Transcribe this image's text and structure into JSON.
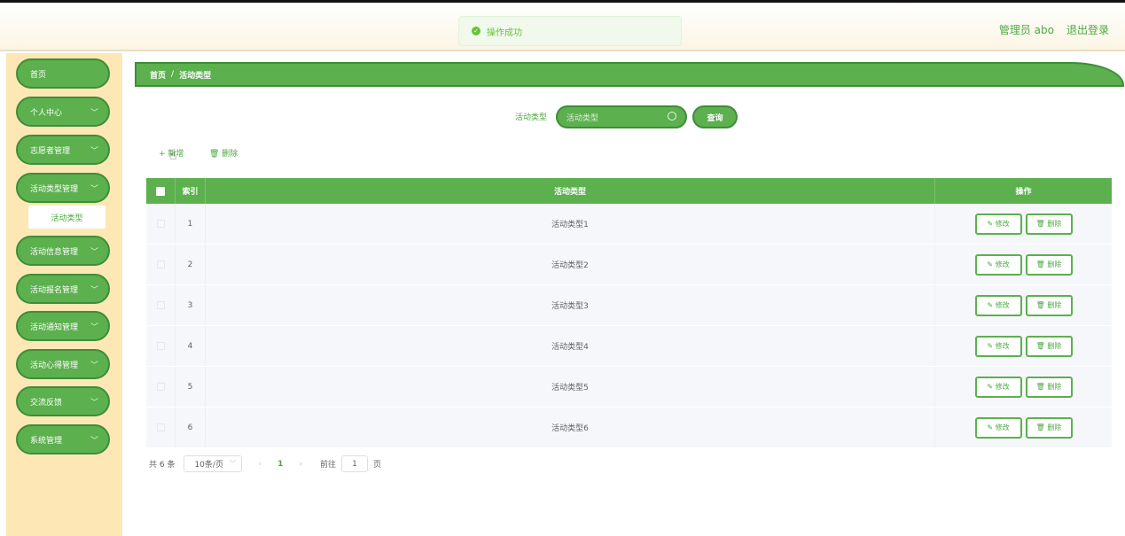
{
  "header": {
    "toast": "操作成功",
    "user_label": "管理员 abo",
    "logout": "退出登录",
    "colors": {
      "accent": "#5cb04e",
      "accent_border": "#3e8e37",
      "sidebar_bg": "#fde8b5",
      "toast_bg": "#f0f9eb",
      "toast_text": "#67c23a"
    }
  },
  "sidebar": {
    "items": [
      {
        "label": "首页"
      },
      {
        "label": "个人中心"
      },
      {
        "label": "志愿者管理"
      },
      {
        "label": "活动类型管理"
      },
      {
        "label": "活动信息管理"
      },
      {
        "label": "活动报名管理"
      },
      {
        "label": "活动通知管理"
      },
      {
        "label": "活动心得管理"
      },
      {
        "label": "交流反馈"
      },
      {
        "label": "系统管理"
      }
    ],
    "submenu": {
      "label": "活动类型"
    }
  },
  "breadcrumb": {
    "home": "首页",
    "sep": "/",
    "current": "活动类型"
  },
  "search": {
    "label": "活动类型",
    "placeholder": "活动类型",
    "button": "查询"
  },
  "toolbar": {
    "add": "+ 新增",
    "delete": "删除"
  },
  "table": {
    "headers": {
      "index": "索引",
      "name": "活动类型",
      "ops": "操作"
    },
    "edit_label": "修改",
    "delete_label": "删除",
    "rows": [
      {
        "index": "1",
        "name": "活动类型1"
      },
      {
        "index": "2",
        "name": "活动类型2"
      },
      {
        "index": "3",
        "name": "活动类型3"
      },
      {
        "index": "4",
        "name": "活动类型4"
      },
      {
        "index": "5",
        "name": "活动类型5"
      },
      {
        "index": "6",
        "name": "活动类型6"
      }
    ]
  },
  "pagination": {
    "total": "共 6 条",
    "page_size": "10条/页",
    "prev": "‹",
    "current": "1",
    "next": "›",
    "goto": "前往",
    "page_input": "1",
    "page_unit": "页"
  }
}
